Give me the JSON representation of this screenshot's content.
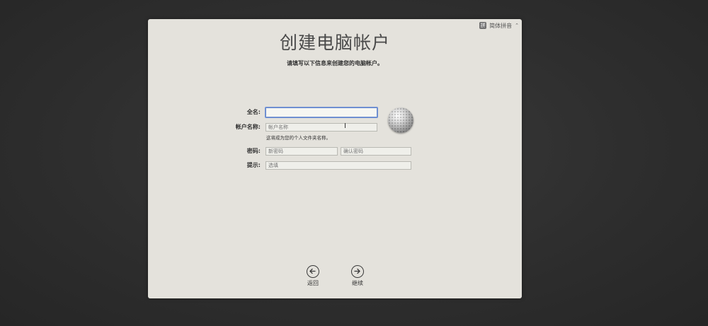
{
  "ime": {
    "badge": "拼",
    "label": "简体拼音"
  },
  "page": {
    "title": "创建电脑帐户",
    "subtitle": "请填写以下信息来创建您的电脑帐户。"
  },
  "form": {
    "full_name": {
      "label": "全名:",
      "value": "",
      "placeholder": ""
    },
    "account_name": {
      "label": "帐户名称:",
      "value": "",
      "placeholder": "帐户名称",
      "hint": "这将成为您的个人文件夹名称。"
    },
    "password": {
      "label": "密码:",
      "placeholder": "新密码",
      "verify_placeholder": "确认密码"
    },
    "hint": {
      "label": "提示:",
      "placeholder": "选填"
    }
  },
  "nav": {
    "back_label": "返回",
    "continue_label": "继续"
  },
  "colors": {
    "focus_ring": "#6f8fd1",
    "panel": "#e4e2dc"
  }
}
